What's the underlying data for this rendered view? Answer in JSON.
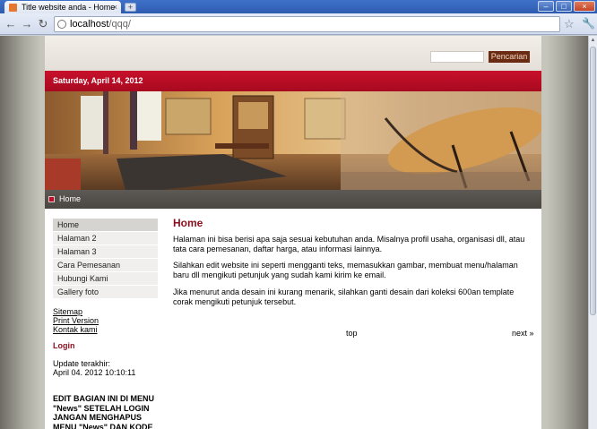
{
  "browser": {
    "tab_title": "Title website anda - Home",
    "url_host": "localhost",
    "url_path": "/qqq/",
    "close_tab": "×",
    "new_tab": "+",
    "win_min": "–",
    "win_max": "□",
    "win_close": "×",
    "back": "←",
    "forward": "→",
    "reload": "↻",
    "star": "☆",
    "wrench": "🔧"
  },
  "header": {
    "search_button": "Pencarian",
    "date": "Saturday, April 14, 2012",
    "home_link": "Home"
  },
  "sidebar": {
    "items": [
      {
        "label": "Home"
      },
      {
        "label": "Halaman 2"
      },
      {
        "label": "Halaman 3"
      },
      {
        "label": "Cara Pemesanan"
      },
      {
        "label": "Hubungi Kami"
      },
      {
        "label": "Gallery foto"
      }
    ],
    "links": [
      "Sitemap",
      "Print Version",
      "Kontak kami"
    ],
    "login": "Login",
    "update_label": "Update terakhir:",
    "update_date": "April 04. 2012 10:10:11",
    "edit_note": "EDIT BAGIAN INI DI MENU \"News\" SETELAH LOGIN JANGAN MENGHAPUS MENU \"News\" DAN KODE \"cmsimple"
  },
  "main": {
    "title": "Home",
    "paragraphs": [
      "Halaman ini bisa berisi apa saja sesuai kebutuhan anda. Misalnya profil usaha, organisasi dll, atau tata cara pemesanan, daftar harga, atau informasi lainnya.",
      "Silahkan edit website ini seperti mengganti teks, memasukkan gambar, membuat menu/halaman baru dll mengikuti petunjuk yang sudah kami kirim ke email.",
      "Jika menurut anda desain ini kurang menarik, silahkan ganti desain dari koleksi 600an template corak mengikuti petunjuk tersebut."
    ],
    "top_link": "top",
    "next_link": "next »"
  }
}
